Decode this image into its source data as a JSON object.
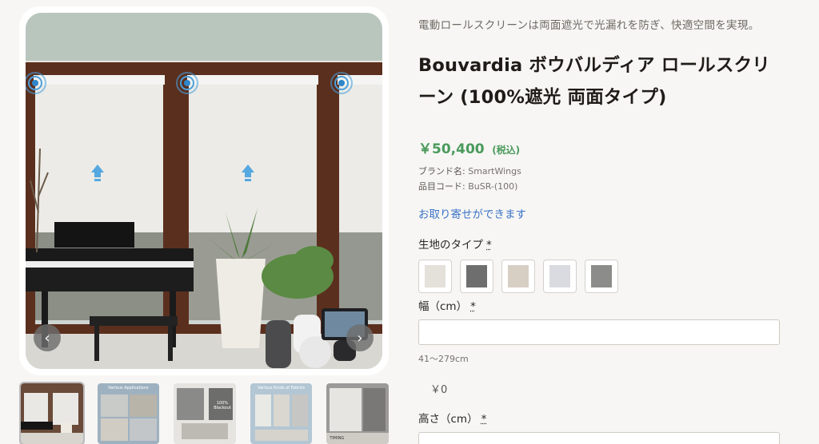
{
  "gallery": {
    "prev_icon": "‹",
    "next_icon": "›",
    "thumbnails": [
      {
        "caption": ""
      },
      {
        "caption": "Various Applications"
      },
      {
        "caption": "100% Blackout"
      },
      {
        "caption": "Various Kinds of Fabrics"
      },
      {
        "caption": "TIMING"
      }
    ]
  },
  "product": {
    "tagline": "電動ロールスクリーンは両面遮光で光漏れを防ぎ、快適空間を実現。",
    "title": "Bouvardia ボウバルディア ロールスクリーン (100%遮光 両面タイプ)",
    "price": "￥50,400",
    "tax_note": "(税込)",
    "brand_key": "ブランド名:",
    "brand_value": "SmartWings",
    "code_key": "品目コード:",
    "code_value": "BuSR-(100)",
    "order_link": "お取り寄せができます"
  },
  "options": {
    "fabric_label": "生地のタイプ",
    "required_mark": "*",
    "swatches": [
      {
        "color": "#e4e0da",
        "name": "light-beige-swatch"
      },
      {
        "color": "#6e6e6e",
        "name": "dark-grey-swatch"
      },
      {
        "color": "#d8cfc4",
        "name": "sand-swatch"
      },
      {
        "color": "#d9dbe0",
        "name": "light-grey-swatch"
      },
      {
        "color": "#8c8c8a",
        "name": "grey-swatch"
      }
    ],
    "width_label": "幅（cm）",
    "width_value": "",
    "width_range": "41〜279cm",
    "calc_price": "￥0",
    "height_label": "高さ（cm）",
    "height_value": ""
  },
  "colors": {
    "price_green": "#4a9a5c",
    "link_blue": "#3b73c7",
    "window_frame": "#5b2f1e"
  }
}
